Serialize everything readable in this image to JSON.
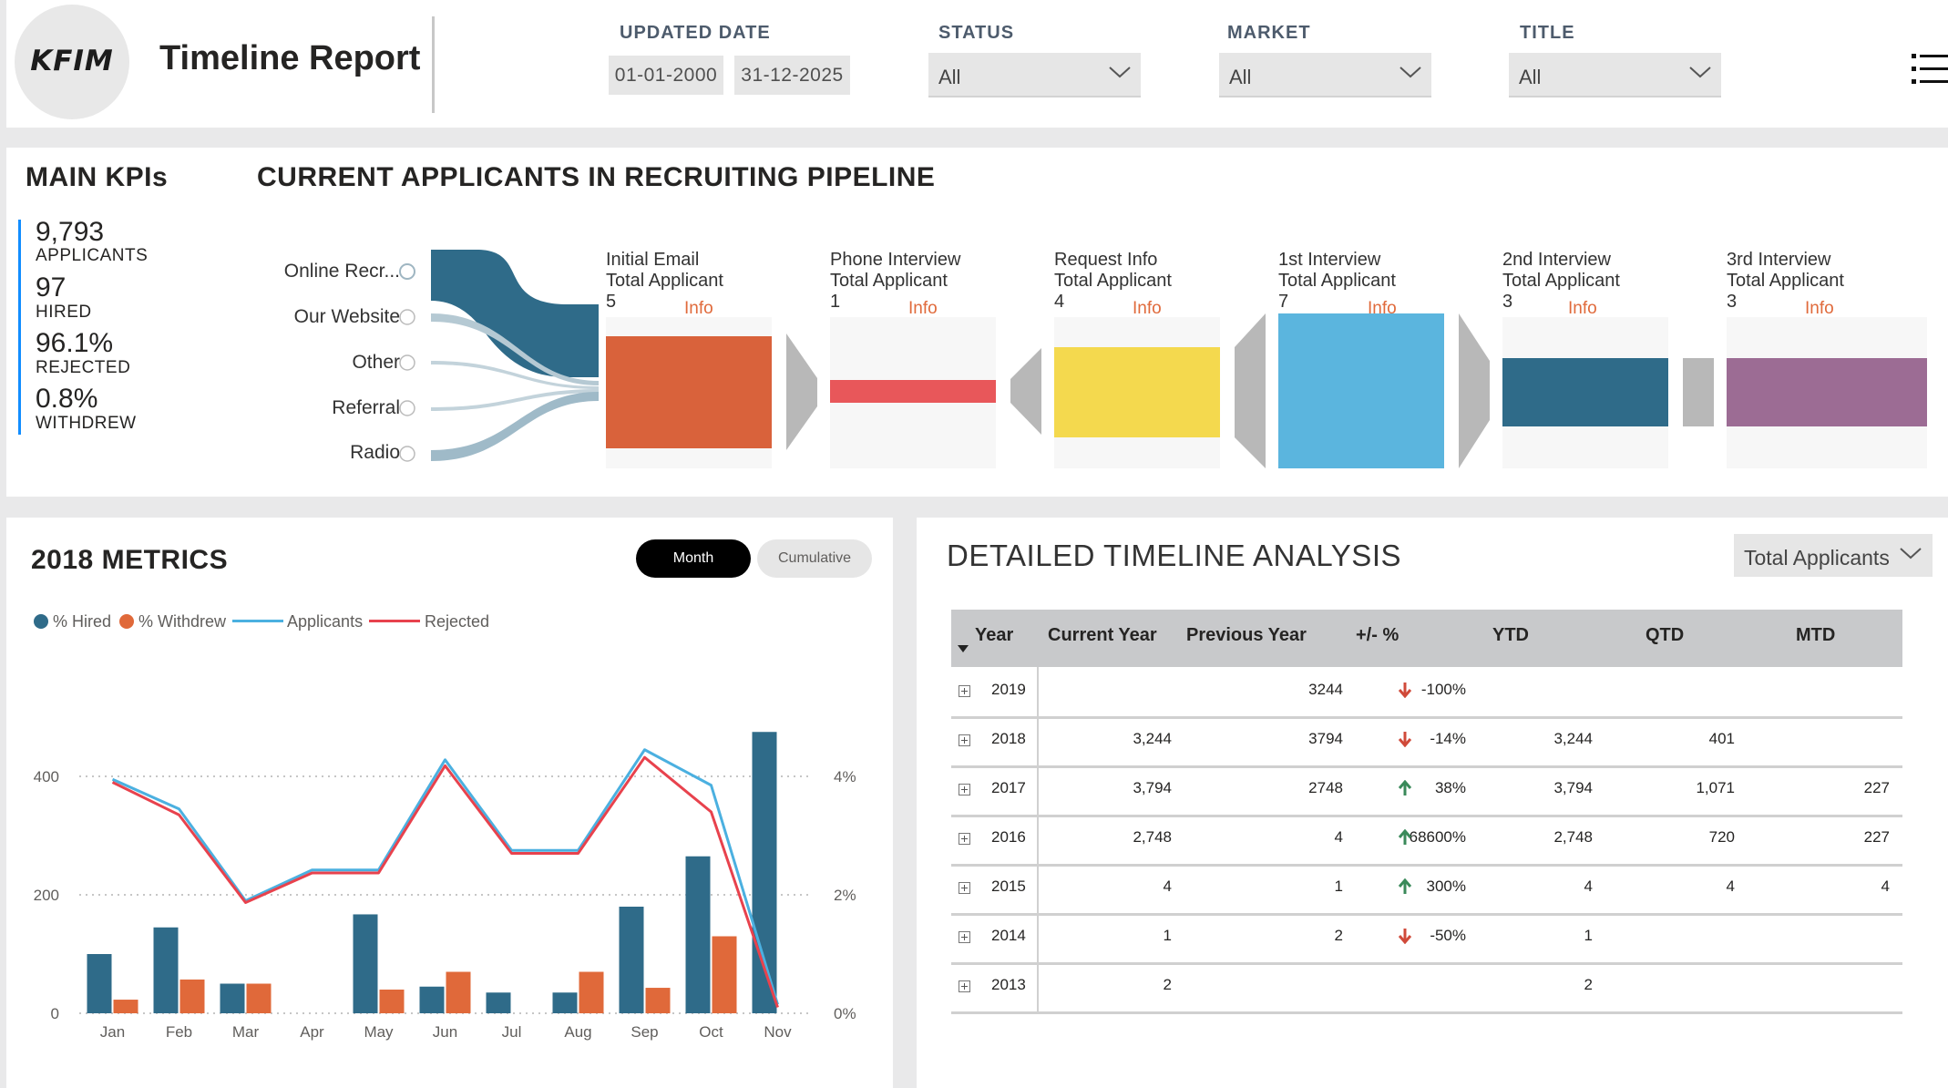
{
  "header": {
    "logo_text": "KFIM",
    "title": "Timeline Report",
    "filters": {
      "updated_date": {
        "label": "UPDATED DATE",
        "start": "01-01-2000",
        "end": "31-12-2025"
      },
      "status": {
        "label": "STATUS",
        "value": "All"
      },
      "market": {
        "label": "MARKET",
        "value": "All"
      },
      "title_filter": {
        "label": "TITLE",
        "value": "All"
      }
    },
    "menu_icon": "hamburger-list-icon"
  },
  "kpis": {
    "title": "MAIN KPIs",
    "items": [
      {
        "value": "9,793",
        "label": "APPLICANTS"
      },
      {
        "value": "97",
        "label": "HIRED"
      },
      {
        "value": "96.1%",
        "label": "REJECTED"
      },
      {
        "value": "0.8%",
        "label": "WITHDREW"
      }
    ]
  },
  "pipeline": {
    "title": "CURRENT APPLICANTS IN RECRUITING PIPELINE",
    "sources": [
      "Online Recr...",
      "Our Website",
      "Other",
      "Referral",
      "Radio"
    ],
    "stages": [
      {
        "name": "Initial Email",
        "metric": "Total Applicant",
        "value": "5",
        "info": "Info",
        "color": "#d9623b"
      },
      {
        "name": "Phone Interview",
        "metric": "Total Applicant",
        "value": "1",
        "info": "Info",
        "color": "#e8575a"
      },
      {
        "name": "Request Info",
        "metric": "Total Applicant",
        "value": "4",
        "info": "Info",
        "color": "#f4d94e"
      },
      {
        "name": "1st Interview",
        "metric": "Total Applicant",
        "value": "7",
        "info": "Info",
        "color": "#5bb5de"
      },
      {
        "name": "2nd Interview",
        "metric": "Total Applicant",
        "value": "3",
        "info": "Info",
        "color": "#2f6b89"
      },
      {
        "name": "3rd Interview",
        "metric": "Total Applicant",
        "value": "3",
        "info": "Info",
        "color": "#9c6c94"
      }
    ]
  },
  "metrics": {
    "title": "2018 METRICS",
    "toggle": {
      "month": "Month",
      "cumulative": "Cumulative"
    },
    "legend": [
      "% Hired",
      "% Withdrew",
      "Applicants",
      "Rejected"
    ]
  },
  "chart_data": {
    "type": "bar",
    "categories": [
      "Jan",
      "Feb",
      "Mar",
      "Apr",
      "May",
      "Jun",
      "Jul",
      "Aug",
      "Sep",
      "Oct",
      "Nov"
    ],
    "series": [
      {
        "name": "% Hired",
        "axis": "right",
        "unit": "%",
        "color": "#2f6b89",
        "values": [
          1.0,
          1.45,
          0.5,
          0,
          1.67,
          0.45,
          0.35,
          0.35,
          1.8,
          2.65,
          4.75
        ]
      },
      {
        "name": "% Withdrew",
        "axis": "right",
        "unit": "%",
        "color": "#e0693a",
        "values": [
          0.23,
          0.57,
          0.5,
          0,
          0.4,
          0.7,
          0,
          0.7,
          0.43,
          1.3,
          0
        ]
      },
      {
        "name": "Applicants",
        "axis": "left",
        "type": "line",
        "color": "#4bb0e0",
        "values": [
          395,
          345,
          190,
          242,
          242,
          428,
          275,
          275,
          445,
          385,
          15
        ]
      },
      {
        "name": "Rejected",
        "axis": "left",
        "type": "line",
        "color": "#e8424d",
        "values": [
          390,
          335,
          187,
          237,
          237,
          418,
          270,
          270,
          432,
          340,
          10
        ]
      }
    ],
    "y_left": {
      "ticks": [
        "0",
        "200",
        "400"
      ],
      "range": [
        0,
        480
      ]
    },
    "y_right": {
      "ticks": [
        "0%",
        "2%",
        "4%"
      ],
      "range": [
        0,
        4.8
      ]
    },
    "grid": "dotted",
    "legend_position": "top-left"
  },
  "timeline": {
    "title": "DETAILED TIMELINE ANALYSIS",
    "measure": "Total Applicants",
    "columns": [
      "Year",
      "Current Year",
      "Previous Year",
      "+/- %",
      "YTD",
      "QTD",
      "MTD"
    ],
    "rows": [
      {
        "year": "2019",
        "current": "",
        "previous": "3244",
        "pct": "-100%",
        "trend": "down",
        "ytd": "",
        "qtd": "",
        "mtd": ""
      },
      {
        "year": "2018",
        "current": "3,244",
        "previous": "3794",
        "pct": "-14%",
        "trend": "down",
        "ytd": "3,244",
        "qtd": "401",
        "mtd": ""
      },
      {
        "year": "2017",
        "current": "3,794",
        "previous": "2748",
        "pct": "38%",
        "trend": "up",
        "ytd": "3,794",
        "qtd": "1,071",
        "mtd": "227"
      },
      {
        "year": "2016",
        "current": "2,748",
        "previous": "4",
        "pct": "68600%",
        "trend": "up",
        "ytd": "2,748",
        "qtd": "720",
        "mtd": "227"
      },
      {
        "year": "2015",
        "current": "4",
        "previous": "1",
        "pct": "300%",
        "trend": "up",
        "ytd": "4",
        "qtd": "4",
        "mtd": "4"
      },
      {
        "year": "2014",
        "current": "1",
        "previous": "2",
        "pct": "-50%",
        "trend": "down",
        "ytd": "1",
        "qtd": "",
        "mtd": ""
      },
      {
        "year": "2013",
        "current": "2",
        "previous": "",
        "pct": "",
        "trend": "",
        "ytd": "2",
        "qtd": "",
        "mtd": ""
      }
    ]
  }
}
